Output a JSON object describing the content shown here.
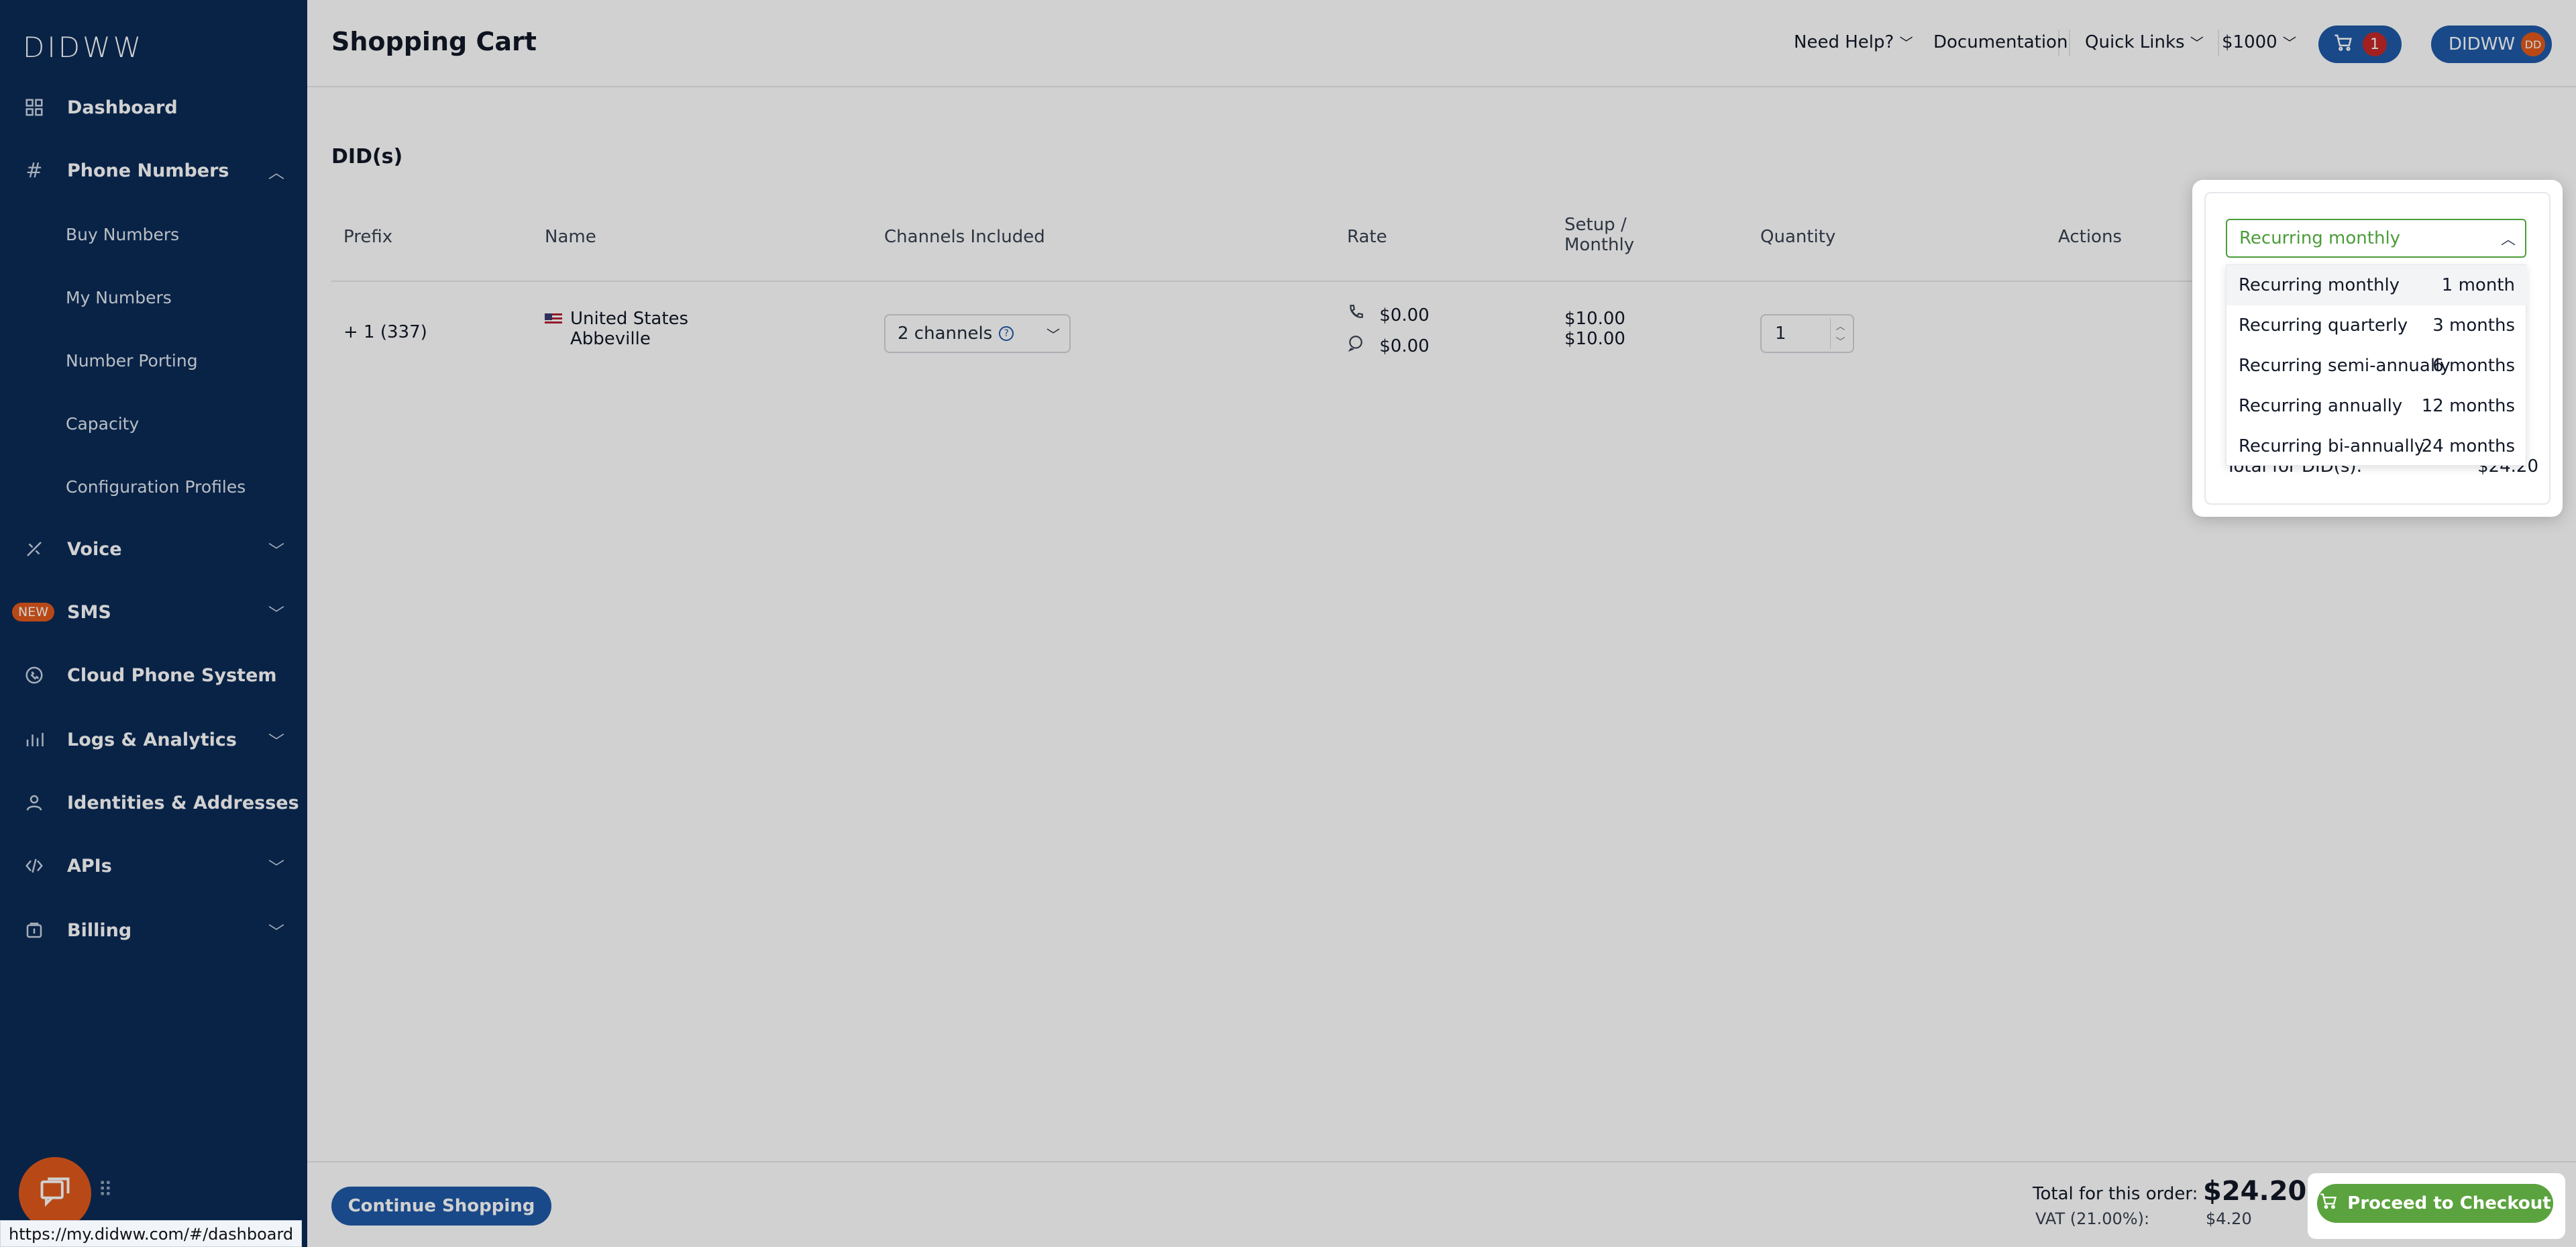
{
  "sidebar": {
    "logo": "DIDWW",
    "items": [
      {
        "label": "Dashboard",
        "icon": "grid-icon"
      },
      {
        "label": "Phone Numbers",
        "icon": "hash-icon"
      },
      {
        "label": "Voice",
        "icon": "voice-icon"
      },
      {
        "label": "SMS",
        "icon": "sms-icon",
        "badge": "NEW"
      },
      {
        "label": "Cloud Phone System",
        "icon": "cloud-phone-icon"
      },
      {
        "label": "Logs & Analytics",
        "icon": "bar-chart-icon"
      },
      {
        "label": "Identities & Addresses",
        "icon": "user-icon"
      },
      {
        "label": "APIs",
        "icon": "code-icon"
      },
      {
        "label": "Billing",
        "icon": "billing-icon"
      }
    ],
    "sub_items": [
      "Buy Numbers",
      "My Numbers",
      "Number Porting",
      "Capacity",
      "Configuration Profiles"
    ],
    "status_url": "https://my.didww.com/#/dashboard"
  },
  "header": {
    "title": "Shopping Cart",
    "need_help": "Need Help?",
    "documentation": "Documentation",
    "quick_links": "Quick Links",
    "balance": "$1000",
    "cart_count": "1",
    "user_name": "DIDWW",
    "user_initials": "DD"
  },
  "cart": {
    "section_title": "DID(s)",
    "columns": {
      "prefix": "Prefix",
      "name": "Name",
      "channels": "Channels Included",
      "rate": "Rate",
      "setup_monthly_1": "Setup /",
      "setup_monthly_2": "Monthly",
      "quantity": "Quantity",
      "actions": "Actions"
    },
    "row": {
      "prefix": "+ 1 (337)",
      "country": "United States",
      "city": "Abbeville",
      "channels": "2 channels",
      "rate_voice": "$0.00",
      "rate_sms": "$0.00",
      "setup": "$10.00",
      "monthly": "$10.00",
      "quantity": "1"
    }
  },
  "billing_popup": {
    "selected": "Recurring monthly",
    "options": [
      {
        "label": "Recurring monthly",
        "period": "1 month"
      },
      {
        "label": "Recurring quarterly",
        "period": "3 months"
      },
      {
        "label": "Recurring semi-annually",
        "period": "6 months"
      },
      {
        "label": "Recurring annually",
        "period": "12 months"
      },
      {
        "label": "Recurring bi-annually",
        "period": "24 months"
      }
    ],
    "total_label": "Total for DID(s):",
    "total_value": "$24.20"
  },
  "footer": {
    "continue": "Continue Shopping",
    "total_label": "Total for this order:",
    "total_value": "$24.20",
    "vat_label": "VAT (21.00%):",
    "vat_value": "$4.20",
    "checkout": "Proceed to Checkout"
  },
  "colors": {
    "sidebar": "#0b2b57",
    "primary": "#1f5aa6",
    "accent_green": "#5ba33e",
    "badge_orange": "#e15a1b"
  }
}
